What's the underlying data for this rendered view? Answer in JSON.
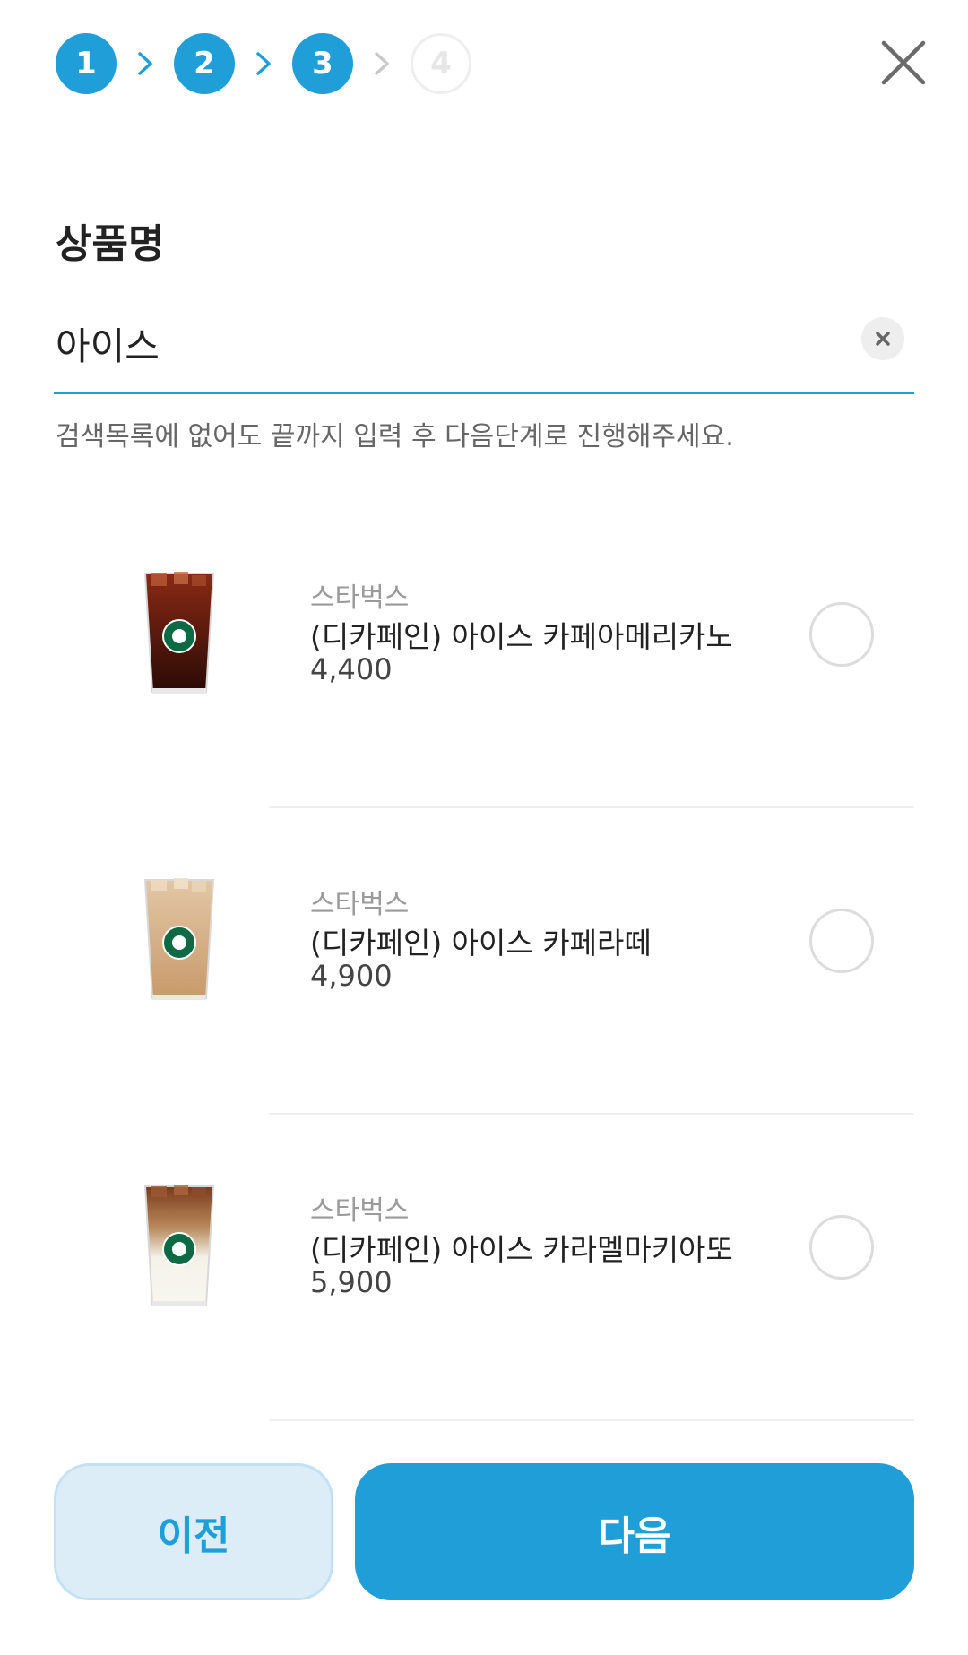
{
  "stepper": {
    "steps": [
      {
        "label": "1",
        "state": "active"
      },
      {
        "label": "2",
        "state": "active"
      },
      {
        "label": "3",
        "state": "active"
      },
      {
        "label": "4",
        "state": "inactive"
      }
    ],
    "accent_color": "#1f9ed8"
  },
  "header": {
    "close_icon": "close-icon"
  },
  "form": {
    "section_title": "상품명",
    "search_value": "아이스",
    "clear_icon": "clear-icon",
    "helper_text": "검색목록에 없어도 끝까지 입력 후 다음단계로 진행해주세요."
  },
  "products": [
    {
      "brand": "스타벅스",
      "name": "(디카페인) 아이스 카페아메리카노",
      "price": "4,400",
      "image_icon": "iced-americano-cup-icon",
      "selected": false
    },
    {
      "brand": "스타벅스",
      "name": "(디카페인) 아이스 카페라떼",
      "price": "4,900",
      "image_icon": "iced-latte-cup-icon",
      "selected": false
    },
    {
      "brand": "스타벅스",
      "name": "(디카페인) 아이스 카라멜마키아또",
      "price": "5,900",
      "image_icon": "iced-caramel-macchiato-cup-icon",
      "selected": false
    }
  ],
  "footer": {
    "prev_label": "이전",
    "next_label": "다음"
  }
}
